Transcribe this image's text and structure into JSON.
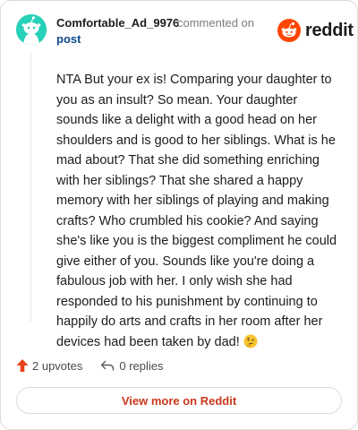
{
  "comment": {
    "username": "Comfortable_Ad_9976",
    "action": "commented on",
    "post_link": "post",
    "body": "NTA But your ex is! Comparing your daughter to you as an insult? So mean. Your daughter sounds like a delight with a good head on her shoulders and is good to her siblings. What is he mad about? That she did something enriching with her siblings? That she shared a happy memory with her siblings of playing and making crafts? Who crumbled his cookie? And saying she's like you is the biggest compliment he could give either of you. Sounds like you're doing a fabulous job with her. I only wish she had responded to his punishment by continuing to happily do arts and crafts in her room after her devices had been taken by dad!",
    "body_emoji": "thinking-face-emoji"
  },
  "logo": {
    "text": "reddit",
    "icon": "reddit-alien-icon",
    "brand_color": "#ff4500"
  },
  "avatar": {
    "icon": "reddit-snoo-avatar",
    "color": "#27d1b8"
  },
  "footer": {
    "upvotes_label": "2 upvotes",
    "replies_label": "0 replies",
    "upvote_icon": "upvote-arrow-icon",
    "upvote_color": "#e8421a",
    "reply_icon": "reply-arrow-icon"
  },
  "view_more": {
    "label": "View more on Reddit",
    "color": "#c8381c"
  }
}
